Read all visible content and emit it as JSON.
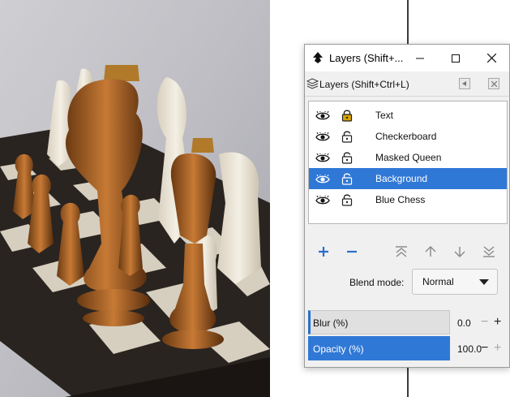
{
  "photo": {
    "description_icon": "chess-photo-image"
  },
  "dialog": {
    "title": "Layers (Shift+...",
    "window_buttons": {
      "minimize": "─",
      "maximize": "☐",
      "close": "✕"
    },
    "tab": {
      "label": "Layers (Shift+Ctrl+L)"
    },
    "layers": [
      {
        "name": "Text",
        "visible": true,
        "locked": true,
        "selected": false
      },
      {
        "name": "Checkerboard",
        "visible": true,
        "locked": false,
        "selected": false
      },
      {
        "name": "Masked Queen",
        "visible": true,
        "locked": false,
        "selected": false
      },
      {
        "name": "Background",
        "visible": true,
        "locked": false,
        "selected": true
      },
      {
        "name": "Blue Chess",
        "visible": true,
        "locked": false,
        "selected": false
      }
    ],
    "toolbar": {
      "add": "+",
      "remove": "−"
    },
    "blend_mode": {
      "label": "Blend mode:",
      "value": "Normal"
    },
    "blur": {
      "label": "Blur (%)",
      "value": "0.0",
      "minus": "−",
      "plus": "+",
      "fraction": 1.0
    },
    "opacity": {
      "label": "Opacity (%)",
      "value": "100.0",
      "minus": "−",
      "plus": "+",
      "fraction": 1.0
    }
  },
  "colors": {
    "selection": "#3078d6",
    "accent_blue": "#2a6fc9",
    "lock_gold": "#d9a300"
  }
}
